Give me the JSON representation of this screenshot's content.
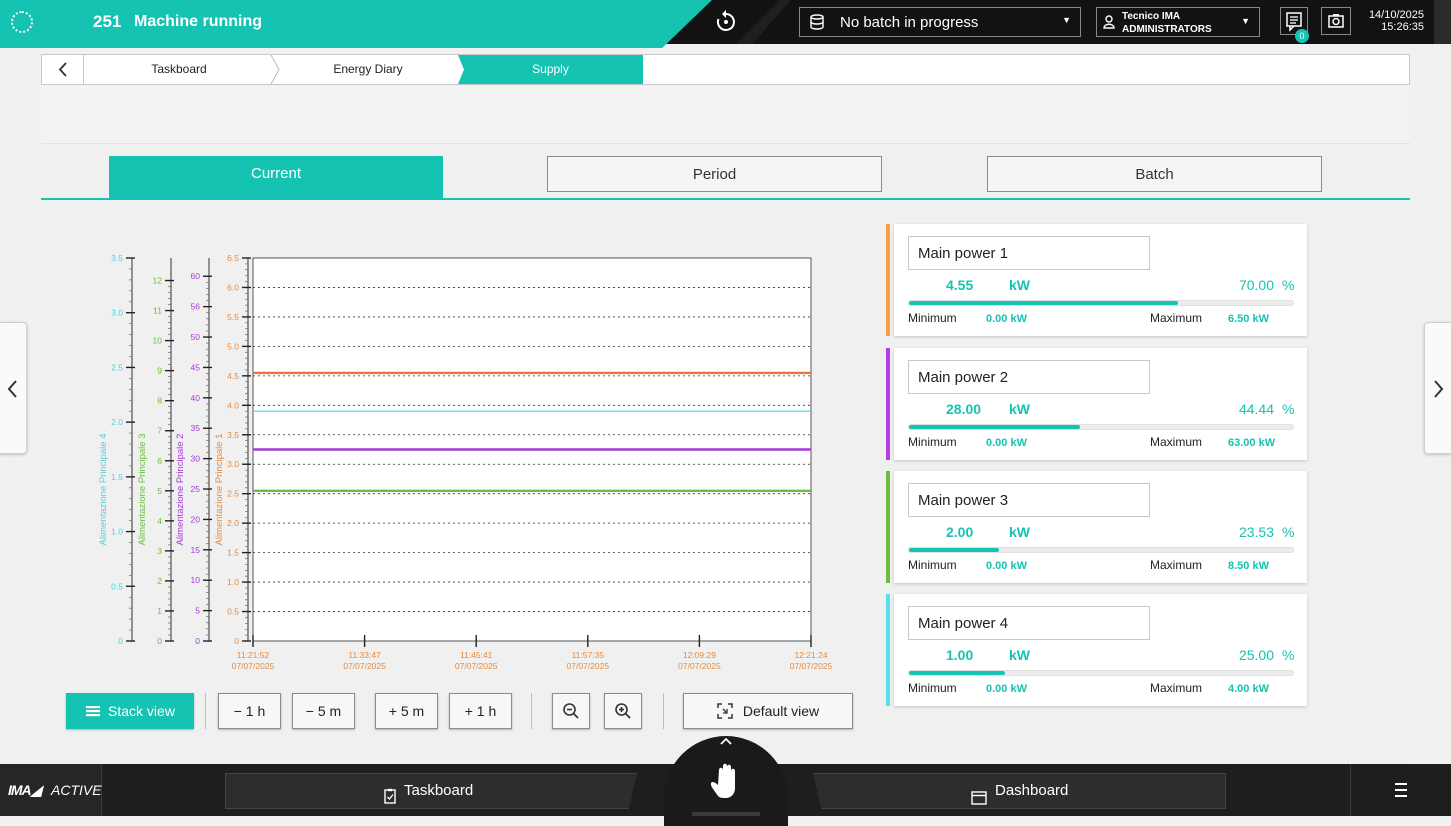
{
  "header": {
    "status_code": "251",
    "status_text": "Machine running",
    "batch_label": "No batch in progress",
    "user_name": "Tecnico IMA",
    "user_group": "ADMINISTRATORS",
    "message_count": "0",
    "date": "14/10/2025",
    "time": "15:26:35"
  },
  "breadcrumb": [
    "Taskboard",
    "Energy Diary",
    "Supply"
  ],
  "tabs": {
    "current": "Current",
    "period": "Period",
    "batch": "Batch"
  },
  "controls": {
    "stack_view": "Stack view",
    "minus_1h": "− 1 h",
    "minus_5m": "− 5 m",
    "plus_5m": "+ 5 m",
    "plus_1h": "+ 1 h",
    "default_view": "Default view"
  },
  "colors": {
    "accent": "#15c3b2",
    "power1": "#f5a044",
    "power2": "#b43de6",
    "power3": "#6bbf3a",
    "power4": "#56e0ea",
    "axis1": "#e88a3a",
    "axis2": "#a33bd6",
    "axis3": "#6bbf3a",
    "axis4": "#4fd3de"
  },
  "cards": [
    {
      "name": "Main power 1",
      "value": "4.55",
      "unit": "kW",
      "percent": "70.00",
      "percent_sign": "%",
      "fraction": 0.7,
      "min_label": "Minimum",
      "min_value": "0.00 kW",
      "max_label": "Maximum",
      "max_value": "6.50 kW"
    },
    {
      "name": "Main power 2",
      "value": "28.00",
      "unit": "kW",
      "percent": "44.44",
      "percent_sign": "%",
      "fraction": 0.4444,
      "min_label": "Minimum",
      "min_value": "0.00 kW",
      "max_label": "Maximum",
      "max_value": "63.00 kW"
    },
    {
      "name": "Main power 3",
      "value": "2.00",
      "unit": "kW",
      "percent": "23.53",
      "percent_sign": "%",
      "fraction": 0.2353,
      "min_label": "Minimum",
      "min_value": "0.00 kW",
      "max_label": "Maximum",
      "max_value": "8.50 kW"
    },
    {
      "name": "Main power 4",
      "value": "1.00",
      "unit": "kW",
      "percent": "25.00",
      "percent_sign": "%",
      "fraction": 0.25,
      "min_label": "Minimum",
      "min_value": "0.00 kW",
      "max_label": "Maximum",
      "max_value": "4.00 kW"
    }
  ],
  "chart_data": {
    "type": "line",
    "grid": true,
    "legend": "none",
    "x_ticks": [
      {
        "time": "11:21:52",
        "date": "07/07/2025"
      },
      {
        "time": "11:33:47",
        "date": "07/07/2025"
      },
      {
        "time": "11:45:41",
        "date": "07/07/2025"
      },
      {
        "time": "11:57:35",
        "date": "07/07/2025"
      },
      {
        "time": "12:09:29",
        "date": "07/07/2025"
      },
      {
        "time": "12:21:24",
        "date": "07/07/2025"
      }
    ],
    "axes": [
      {
        "id": "a1",
        "label": "Alimentazione Principale 1",
        "color": "#e88a3a",
        "min": 0,
        "max": 6.5,
        "ticks": [
          "0",
          "0.5",
          "1.0",
          "1.5",
          "2.0",
          "2.5",
          "3.0",
          "3.5",
          "4.0",
          "4.5",
          "5.0",
          "5.5",
          "6.0",
          "6.5"
        ]
      },
      {
        "id": "a2",
        "label": "Alimentazione Principale 2",
        "color": "#a33bd6",
        "min": 0,
        "max": 63,
        "ticks": [
          "0",
          "5",
          "10",
          "15",
          "20",
          "25",
          "30",
          "35",
          "40",
          "45",
          "50",
          "56",
          "60"
        ]
      },
      {
        "id": "a3",
        "label": "Alimentazione Principale 3",
        "color": "#6bbf3a",
        "min": 0,
        "max": 12.75,
        "ticks": [
          "0",
          "1",
          "2",
          "3",
          "4",
          "5",
          "6",
          "7",
          "8",
          "9",
          "10",
          "11",
          "12"
        ]
      },
      {
        "id": "a4",
        "label": "Alimentazione Principale 4",
        "color": "#4fd3de",
        "min": 0,
        "max": 3.5,
        "ticks": [
          "0",
          "0.5",
          "1.0",
          "1.5",
          "2.0",
          "2.5",
          "3.0",
          "3.5"
        ]
      }
    ],
    "series": [
      {
        "name": "Alimentazione Principale 1",
        "axis": "a1",
        "color": "#e8773a",
        "values": [
          4.55,
          4.55
        ]
      },
      {
        "name": "Alimentazione Principale 4",
        "axis": "a4",
        "color": "#56e0ea",
        "values": [
          2.1,
          2.1
        ]
      },
      {
        "name": "Alimentazione Principale 2",
        "axis": "a2",
        "color": "#a33bd6",
        "values": [
          31.5,
          31.5
        ]
      },
      {
        "name": "Alimentazione Principale 3",
        "axis": "a3",
        "color": "#6bbf3a",
        "values": [
          5.0,
          5.0
        ]
      }
    ]
  }
}
